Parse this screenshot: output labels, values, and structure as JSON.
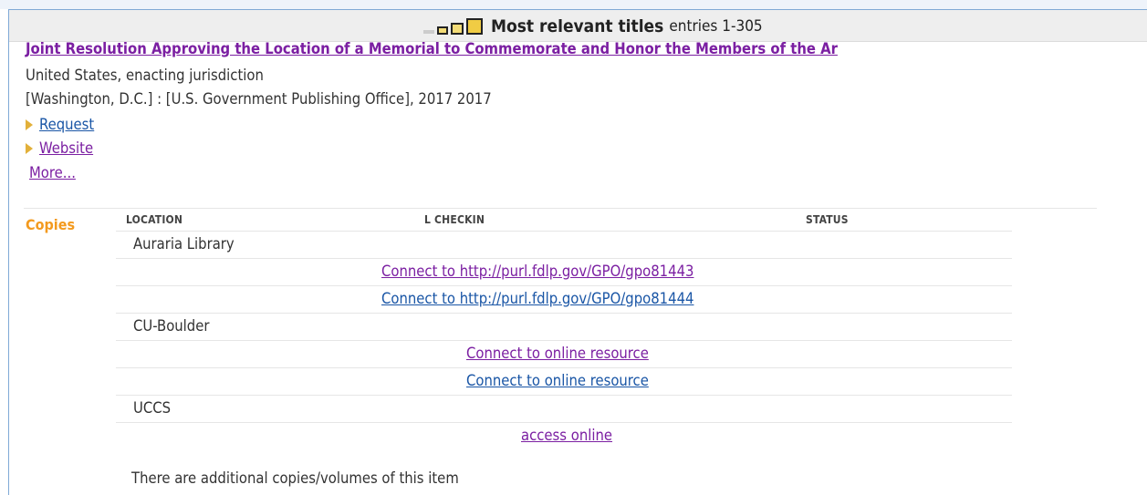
{
  "header": {
    "title": "Most relevant titles",
    "entries": "entries 1-305"
  },
  "record": {
    "title": "Joint Resolution Approving the Location of a Memorial to Commemorate and Honor the Members of the Ar",
    "author": "United States, enacting jurisdiction",
    "publisher": "[Washington, D.C.] : [U.S. Government Publishing Office], 2017 2017",
    "actions": {
      "request": "Request",
      "website": "Website",
      "more": "More..."
    }
  },
  "copies": {
    "label": "Copies",
    "columns": {
      "location": "LOCATION",
      "checkin": "L CHECKIN",
      "status": "STATUS"
    },
    "locations": [
      {
        "name": "Auraria Library",
        "links": [
          "Connect to http://purl.fdlp.gov/GPO/gpo81443",
          "Connect to http://purl.fdlp.gov/GPO/gpo81444"
        ]
      },
      {
        "name": "CU-Boulder",
        "links": [
          "Connect to online resource",
          "Connect to online resource"
        ]
      },
      {
        "name": "UCCS",
        "links": [
          "access online"
        ]
      }
    ],
    "footer": "There are additional copies/volumes of this item"
  },
  "colors": {
    "visited_link": "#7b1fa2",
    "link": "#1a56a6",
    "copies_label": "#f39a1e"
  }
}
